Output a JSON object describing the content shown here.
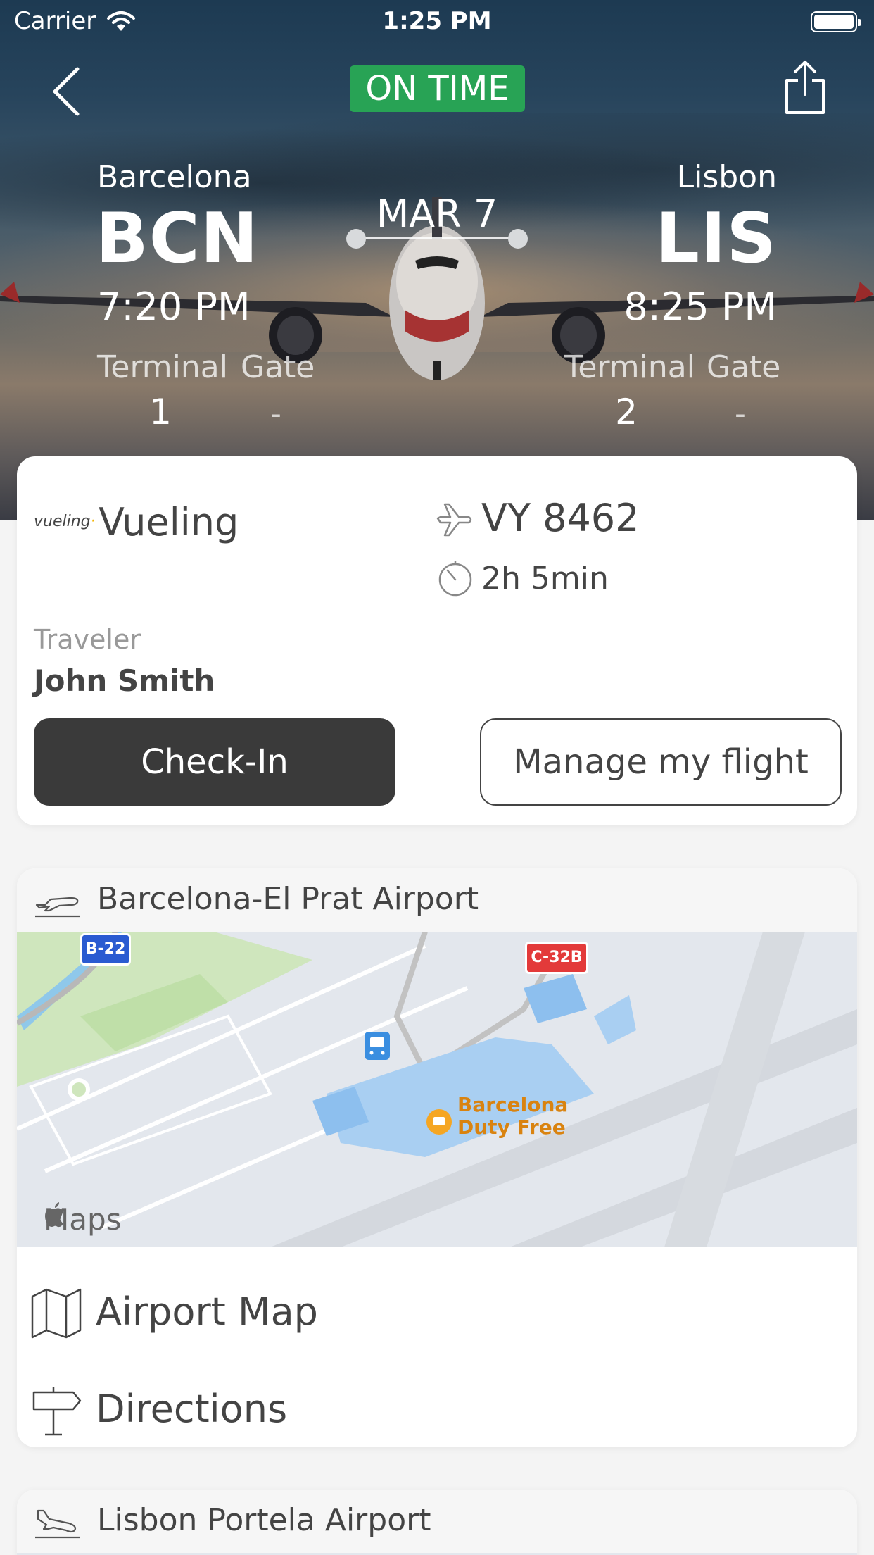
{
  "status_bar": {
    "carrier": "Carrier",
    "time": "1:25 PM"
  },
  "header": {
    "status": "ON TIME",
    "status_color": "#28a355"
  },
  "departure": {
    "city": "Barcelona",
    "code": "BCN",
    "time": "7:20 PM",
    "terminal_label": "Terminal",
    "gate_label": "Gate",
    "terminal": "1",
    "gate": "-"
  },
  "arrival": {
    "city": "Lisbon",
    "code": "LIS",
    "time": "8:25 PM",
    "terminal_label": "Terminal",
    "gate_label": "Gate",
    "terminal": "2",
    "gate": "-"
  },
  "date": "MAR 7",
  "flight": {
    "airline_logo": "vueling",
    "airline": "Vueling",
    "number": "VY 8462",
    "duration": "2h 5min",
    "traveler_label": "Traveler",
    "traveler_name": "John Smith",
    "checkin_label": "Check-In",
    "manage_label": "Manage my flight"
  },
  "departure_airport": {
    "name": "Barcelona-El Prat Airport",
    "map": {
      "shield_b22": "B-22",
      "shield_c32b": "C-32B",
      "poi_line1": "Barcelona",
      "poi_line2": "Duty Free",
      "maps_logo": "Maps"
    },
    "airport_map_label": "Airport Map",
    "directions_label": "Directions"
  },
  "arrival_airport": {
    "name": "Lisbon Portela Airport"
  },
  "colors": {
    "dark_button": "#3a3a3a",
    "shield_blue": "#2a5bd1",
    "shield_red": "#e33a3a",
    "poi_orange": "#d98310"
  }
}
